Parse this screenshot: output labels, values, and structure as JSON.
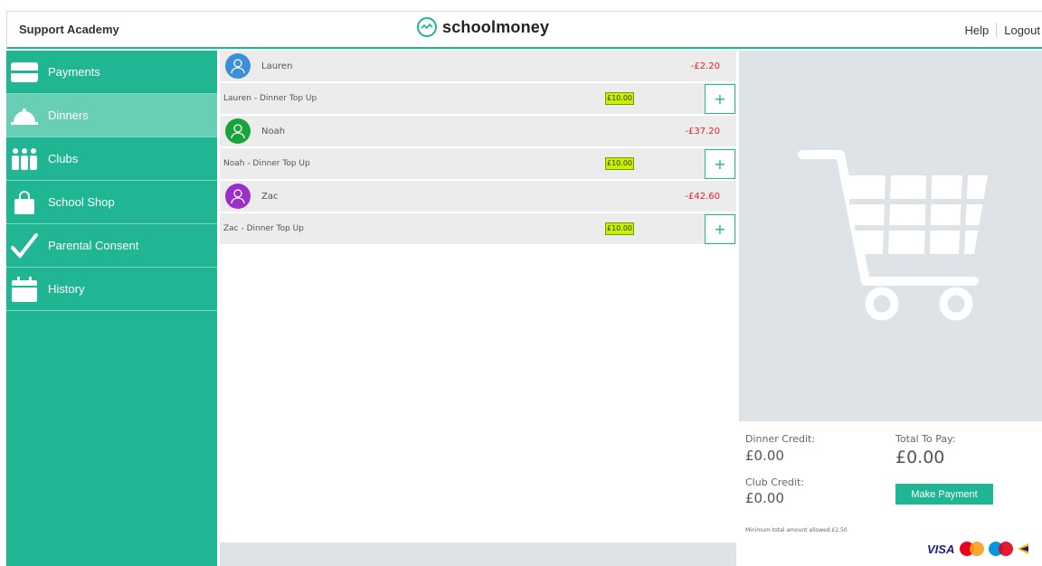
{
  "header": {
    "school_name": "Support Academy",
    "brand": "schoolmoney",
    "links": {
      "help": "Help",
      "logout": "Logout"
    }
  },
  "sidebar": {
    "items": [
      {
        "label": "Payments",
        "icon": "payments-card-icon",
        "active": false
      },
      {
        "label": "Dinners",
        "icon": "dinner-cloche-icon",
        "active": true
      },
      {
        "label": "Clubs",
        "icon": "clubs-people-icon",
        "active": false
      },
      {
        "label": "School Shop",
        "icon": "shopping-bag-icon",
        "active": false
      },
      {
        "label": "Parental Consent",
        "icon": "checkmark-icon",
        "active": false
      },
      {
        "label": "History",
        "icon": "calendar-icon",
        "active": false
      }
    ]
  },
  "students": [
    {
      "name": "Lauren",
      "balance": "-£2.20",
      "avatar_color": "#3b8fd6",
      "topup": {
        "label": "Lauren - Dinner Top Up",
        "amount": "£10.00"
      }
    },
    {
      "name": "Noah",
      "balance": "-£37.20",
      "avatar_color": "#1aa33c",
      "topup": {
        "label": "Noah - Dinner Top Up",
        "amount": "£10.00"
      }
    },
    {
      "name": "Zac",
      "balance": "-£42.60",
      "avatar_color": "#9b2fc9",
      "topup": {
        "label": "Zac - Dinner Top Up",
        "amount": "£10.00"
      }
    }
  ],
  "totals": {
    "dinner_credit_label": "Dinner Credit:",
    "dinner_credit_value": "£0.00",
    "club_credit_label": "Club Credit:",
    "club_credit_value": "£0.00",
    "total_label": "Total To Pay:",
    "total_value": "£0.00",
    "pay_button": "Make Payment",
    "min_note": "Minimum total amount allowed:£2.50"
  },
  "payment_cards": {
    "visa": "VISA"
  },
  "colors": {
    "accent": "#20b593",
    "active_nav": "#68cfb6",
    "negative": "#e02020",
    "panel_bg": "#dde3e6",
    "input_highlight": "#c7f200"
  }
}
